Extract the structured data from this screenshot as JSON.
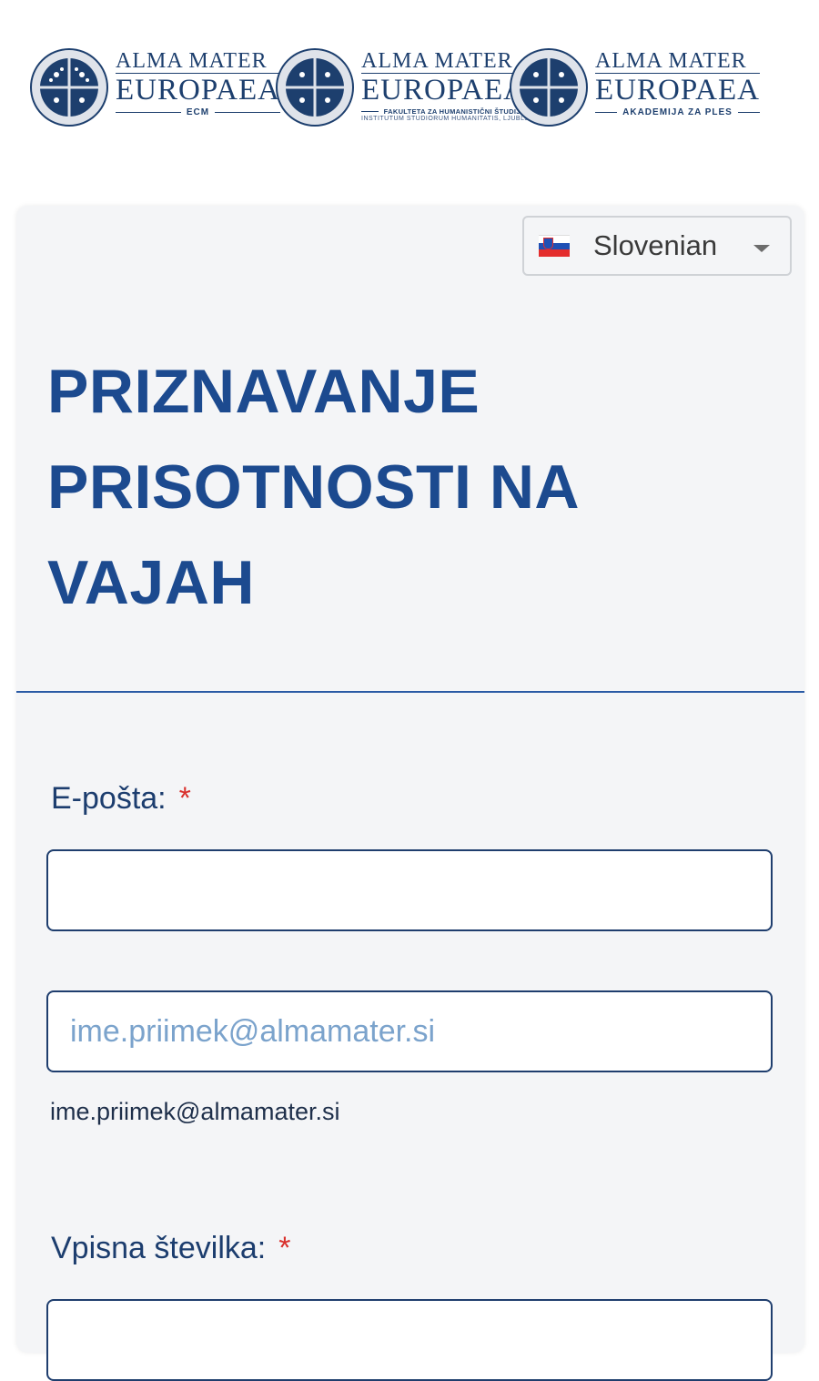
{
  "header": {
    "logos": [
      {
        "top": "ALMA MATER",
        "main": "EUROPAEA",
        "sub": "ECM",
        "sub2": ""
      },
      {
        "top": "ALMA MATER",
        "main": "EUROPAEA",
        "sub": "FAKULTETA ZA HUMANISTIČNI ŠTUDIJ",
        "sub2": "INSTITUTUM STUDIORUM HUMANITATIS, LJUBLJANA"
      },
      {
        "top": "ALMA MATER",
        "main": "EUROPAEA",
        "sub": "AKADEMIJA ZA PLES",
        "sub2": ""
      }
    ]
  },
  "language": {
    "selected": "Slovenian",
    "flag_icon": "slovenia-flag-icon"
  },
  "form": {
    "title": "PRIZNAVANJE PRISOTNOSTI NA VAJAH",
    "fields": {
      "email": {
        "label": "E-pošta:",
        "required_mark": "*",
        "value": ""
      },
      "email_confirm": {
        "placeholder": "ime.priimek@almamater.si",
        "hint": "ime.priimek@almamater.si"
      },
      "vpisna": {
        "label": "Vpisna številka:",
        "required_mark": "*"
      }
    }
  },
  "colors": {
    "brand_navy": "#1d3f6e",
    "title_blue": "#1c4a8f",
    "required_red": "#d9302c",
    "card_bg": "#f4f5f7"
  }
}
